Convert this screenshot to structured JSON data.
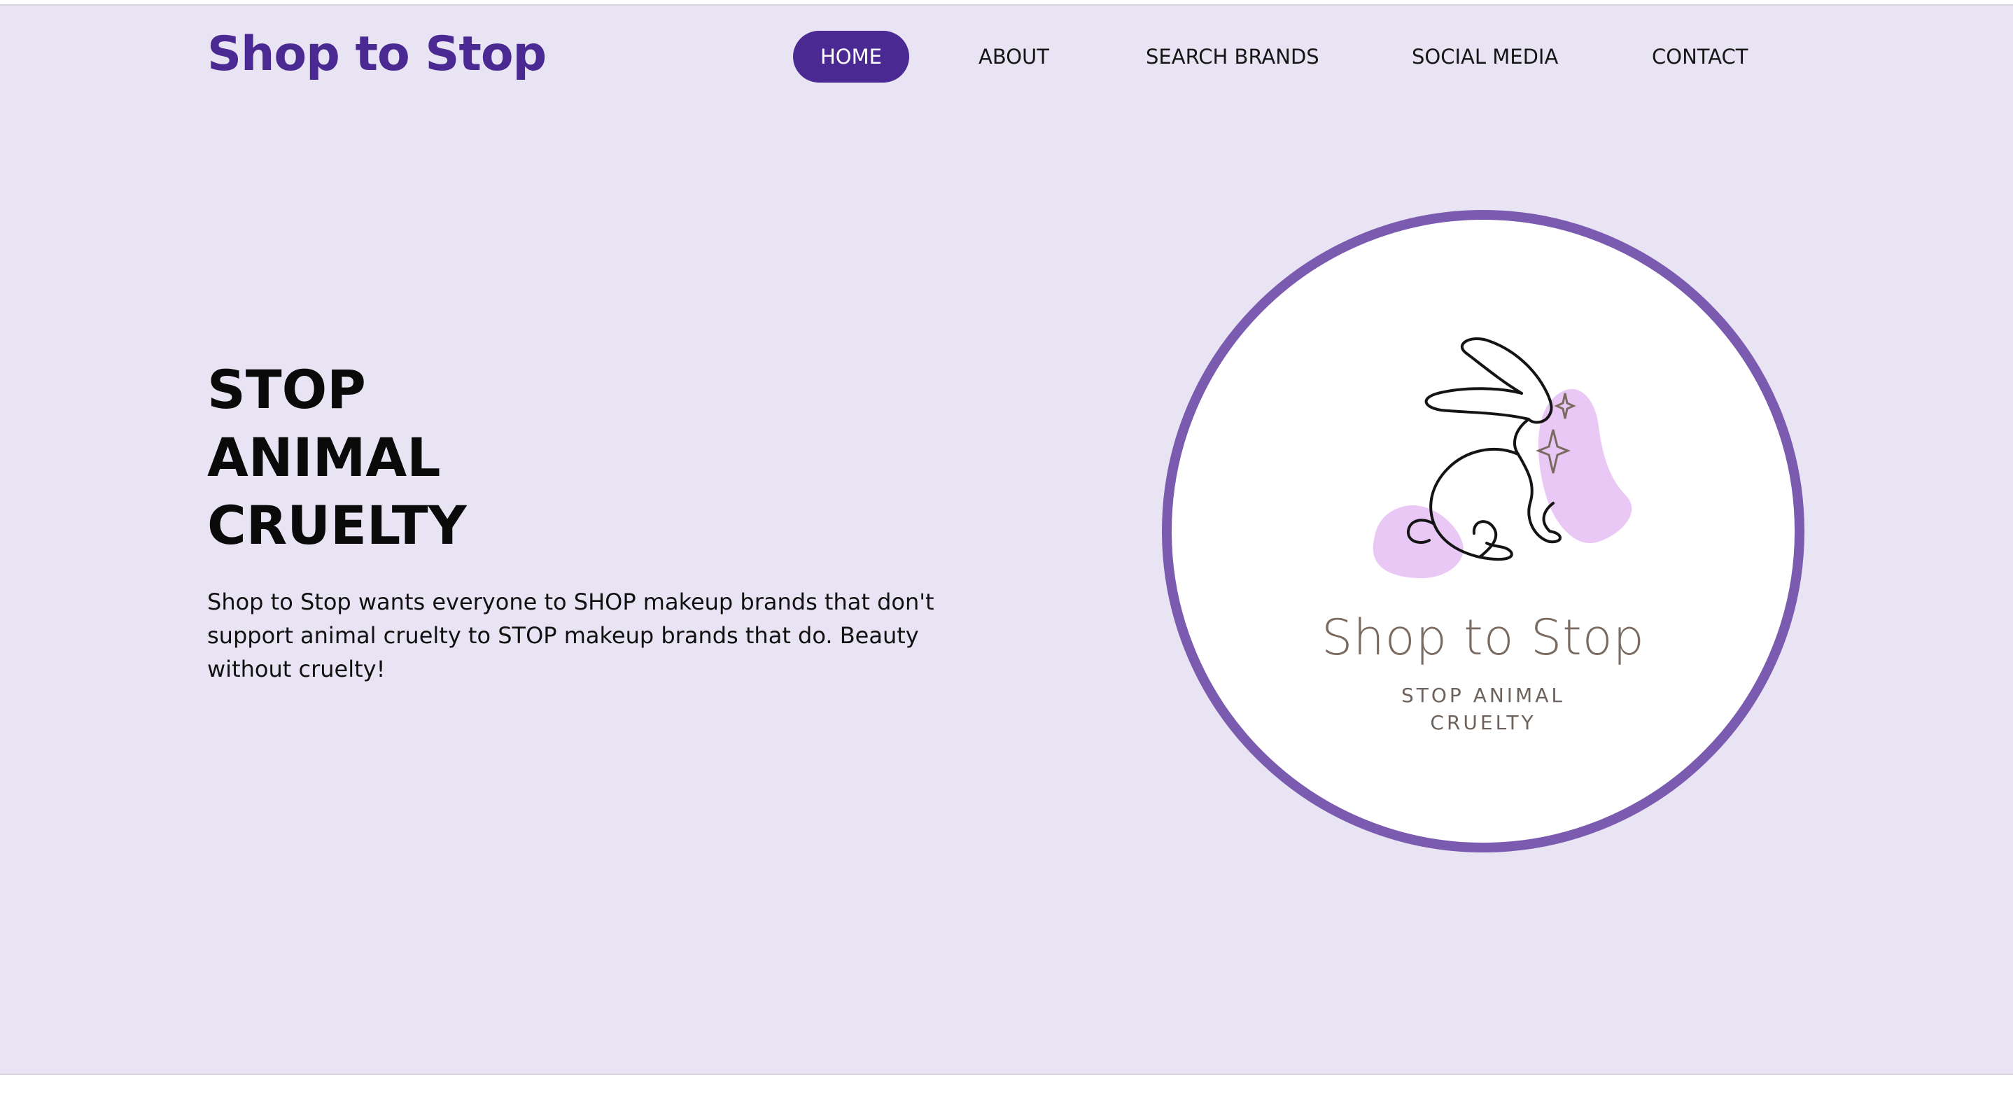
{
  "header": {
    "brand": "Shop to Stop",
    "nav": [
      {
        "label": "HOME",
        "active": true
      },
      {
        "label": "ABOUT",
        "active": false
      },
      {
        "label": "SEARCH BRANDS",
        "active": false
      },
      {
        "label": "SOCIAL MEDIA",
        "active": false
      },
      {
        "label": "CONTACT",
        "active": false
      }
    ]
  },
  "hero": {
    "title_lines": [
      "STOP",
      "ANIMAL",
      "CRUELTY"
    ],
    "description": "Shop to Stop wants everyone to SHOP makeup brands that don't support animal cruelty to STOP makeup brands that do. Beauty without cruelty!"
  },
  "logo": {
    "name": "Shop to Stop",
    "tagline_lines": [
      "STOP ANIMAL",
      "CRUELTY"
    ],
    "icon": "rabbit-icon"
  },
  "colors": {
    "brand": "#4a2a92",
    "background": "#e9e4f4",
    "circle_border": "#7b5bb0",
    "blob": "#eac8f6"
  }
}
